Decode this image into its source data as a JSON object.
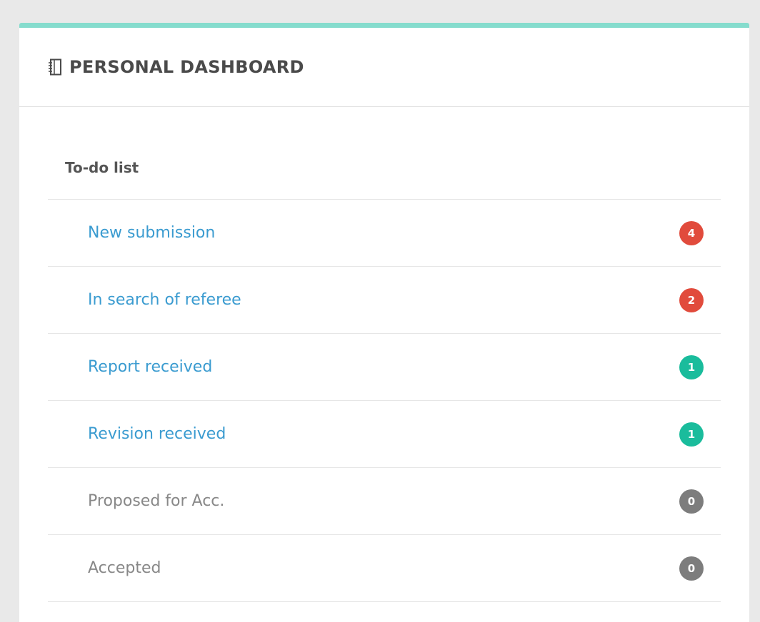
{
  "dashboard": {
    "icon": "notebook-icon",
    "title": "PERSONAL DASHBOARD",
    "accent_color": "#85dccd"
  },
  "todo": {
    "heading": "To-do list",
    "items": [
      {
        "label": "New submission",
        "count": "4",
        "badge_color": "#e14b3c",
        "link": true
      },
      {
        "label": "In search of referee",
        "count": "2",
        "badge_color": "#e14b3c",
        "link": true
      },
      {
        "label": "Report received",
        "count": "1",
        "badge_color": "#1abc9c",
        "link": true
      },
      {
        "label": "Revision received",
        "count": "1",
        "badge_color": "#1abc9c",
        "link": true
      },
      {
        "label": "Proposed for Acc.",
        "count": "0",
        "badge_color": "#7d7d7d",
        "link": false
      },
      {
        "label": "Accepted",
        "count": "0",
        "badge_color": "#7d7d7d",
        "link": false
      }
    ]
  }
}
